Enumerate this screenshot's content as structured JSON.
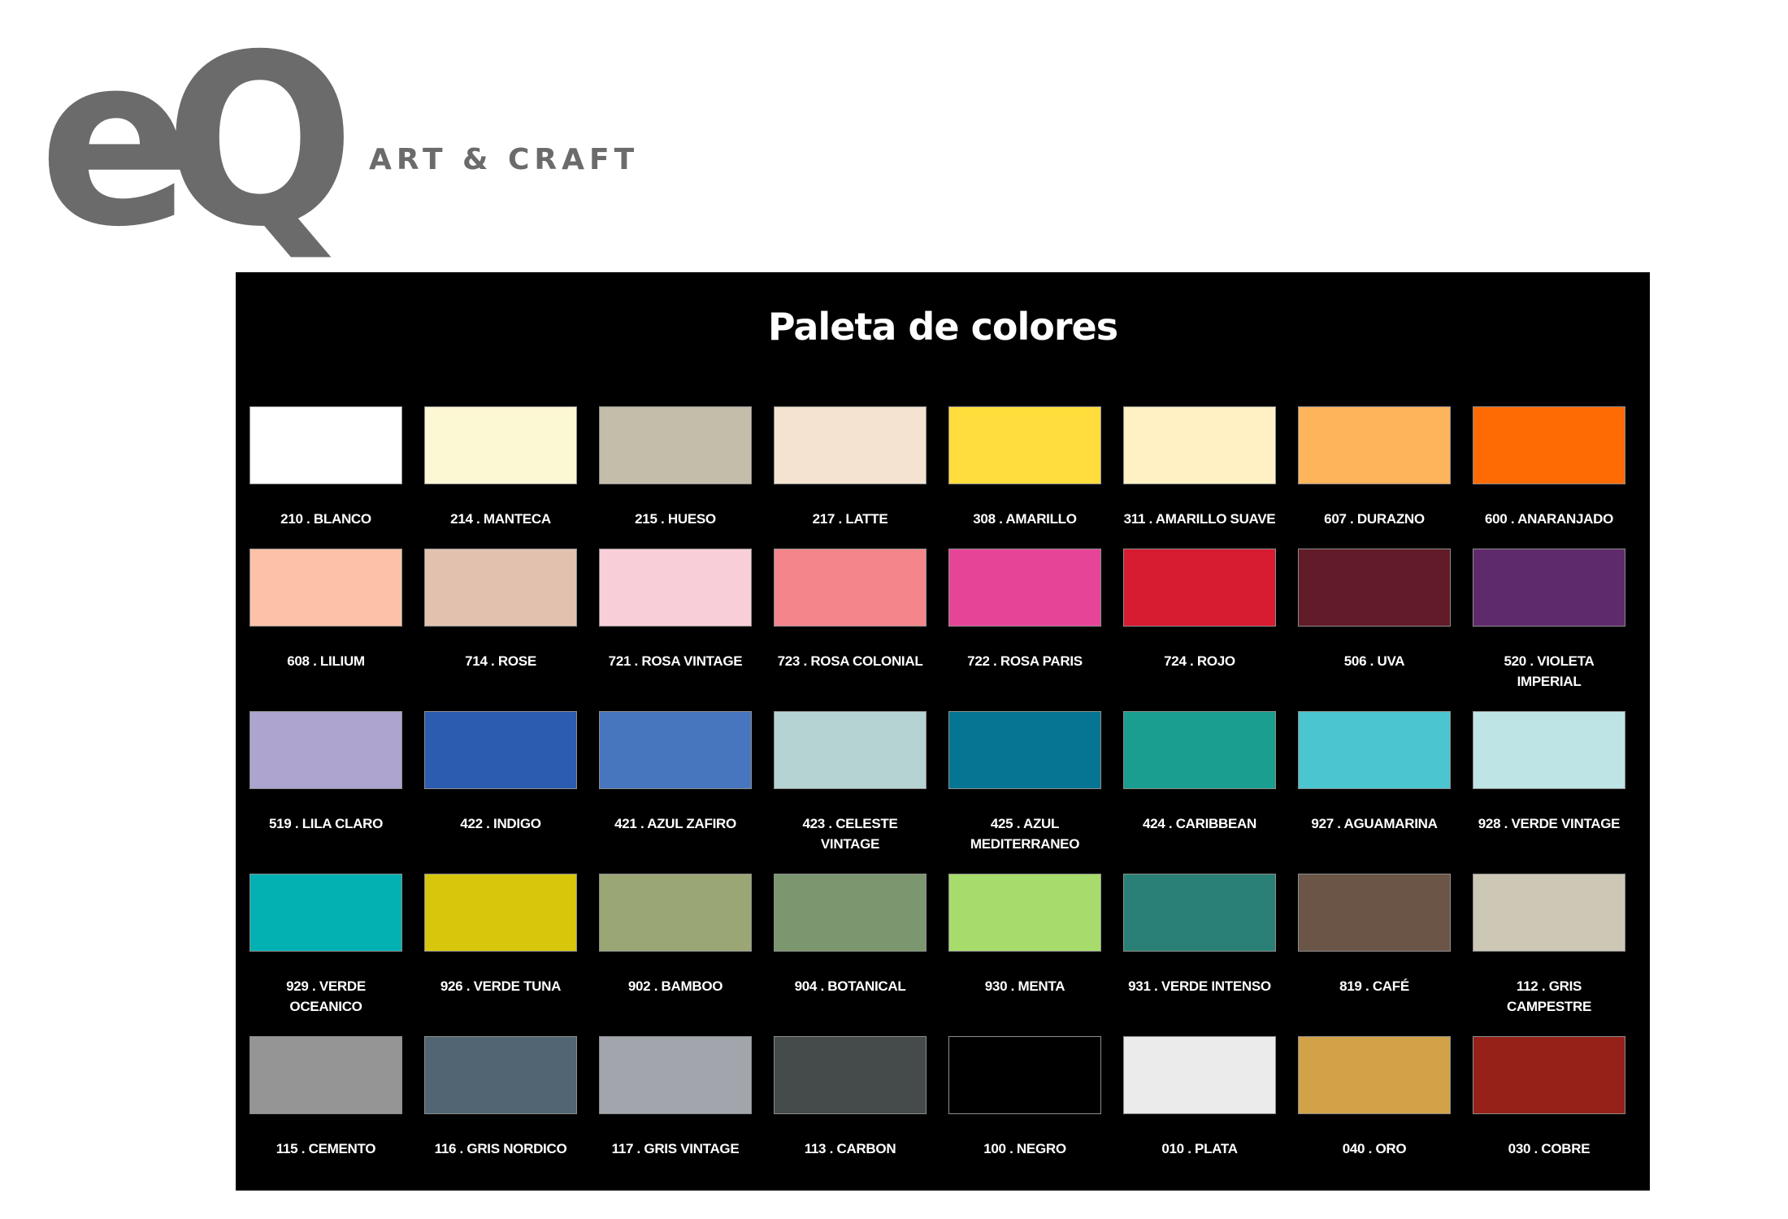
{
  "logo": {
    "mark": "eQ",
    "tagline": "ART & CRAFT",
    "color": "#6b6b6b"
  },
  "palette": {
    "title": "Paleta de colores",
    "rows": [
      [
        {
          "label": "210 . BLANCO",
          "color": "#ffffff"
        },
        {
          "label": "214 . MANTECA",
          "color": "#fdf8d4"
        },
        {
          "label": "215 . HUESO",
          "color": "#c4bda9"
        },
        {
          "label": "217 . LATTE",
          "color": "#f4e3d0"
        },
        {
          "label": "308 . AMARILLO",
          "color": "#fedd3c"
        },
        {
          "label": "311 . AMARILLO SUAVE",
          "color": "#fff1c4"
        },
        {
          "label": "607 . DURAZNO",
          "color": "#fdb45a"
        },
        {
          "label": "600 . ANARANJADO",
          "color": "#fe6a03"
        }
      ],
      [
        {
          "label": "608 . LILIUM",
          "color": "#fcc2a7"
        },
        {
          "label": "714 . ROSE",
          "color": "#e2c2af"
        },
        {
          "label": "721 . ROSA VINTAGE",
          "color": "#f8cfd9"
        },
        {
          "label": "723 . ROSA COLONIAL",
          "color": "#f4868b"
        },
        {
          "label": "722 . ROSA PARIS",
          "color": "#e64497"
        },
        {
          "label": "724 . ROJO",
          "color": "#d71b30"
        },
        {
          "label": "506 . UVA",
          "color": "#621b28"
        },
        {
          "label": "520 . VIOLETA IMPERIAL",
          "color": "#5f2a6c"
        }
      ],
      [
        {
          "label": "519 . LILA CLARO",
          "color": "#ada4d0"
        },
        {
          "label": "422 . INDIGO",
          "color": "#2b5caf"
        },
        {
          "label": "421 . AZUL ZAFIRO",
          "color": "#4776bf"
        },
        {
          "label": "423 . CELESTE VINTAGE",
          "color": "#b6d3d4"
        },
        {
          "label": "425 . AZUL MEDITERRANEO",
          "color": "#067593"
        },
        {
          "label": "424 . CARIBBEAN",
          "color": "#1a9e8f"
        },
        {
          "label": "927 . AGUAMARINA",
          "color": "#4bc5d0"
        },
        {
          "label": "928 . VERDE VINTAGE",
          "color": "#bee4e6"
        }
      ],
      [
        {
          "label": "929 . VERDE OCEANICO",
          "color": "#03b1b3"
        },
        {
          "label": "926 . VERDE TUNA",
          "color": "#d8c60c"
        },
        {
          "label": "902 . BAMBOO",
          "color": "#9ba675"
        },
        {
          "label": "904 . BOTANICAL",
          "color": "#7c976f"
        },
        {
          "label": "930 . MENTA",
          "color": "#a7dc6c"
        },
        {
          "label": "931 . VERDE INTENSO",
          "color": "#2a8076"
        },
        {
          "label": "819 . CAFÉ",
          "color": "#6a5547"
        },
        {
          "label": "112 . GRIS CAMPESTRE",
          "color": "#cdc7b6"
        }
      ],
      [
        {
          "label": "115 . CEMENTO",
          "color": "#959595"
        },
        {
          "label": "116 . GRIS NORDICO",
          "color": "#516572"
        },
        {
          "label": "117 . GRIS VINTAGE",
          "color": "#a2a6ac"
        },
        {
          "label": "113 . CARBON",
          "color": "#454a4a"
        },
        {
          "label": "100 . NEGRO",
          "color": "#000000"
        },
        {
          "label": "010 . PLATA",
          "color": "#ebebeb"
        },
        {
          "label": "040 . ORO",
          "color": "#d2a249"
        },
        {
          "label": "030 . COBRE",
          "color": "#962118"
        }
      ]
    ]
  }
}
